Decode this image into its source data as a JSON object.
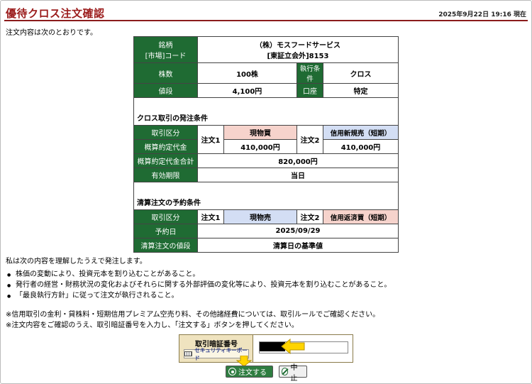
{
  "header": {
    "title": "優待クロス注文確認",
    "datetime": "2025年9月22日 19:16 現在"
  },
  "intro": "注文内容は次のとおりです。",
  "order": {
    "stock_label_1": "銘柄",
    "stock_label_2": "[市場]コード",
    "stock_name": "（株）モスフードサービス",
    "stock_code": "[東証立会外]8153",
    "qty_label": "株数",
    "qty_value": "100株",
    "exec_label": "執行条件",
    "exec_value": "クロス",
    "price_label": "値段",
    "price_value": "4,100円",
    "account_label": "口座",
    "account_value": "特定"
  },
  "cross": {
    "section_title": "クロス取引の発注条件",
    "type_label": "取引区分",
    "estimate_label": "概算約定代金",
    "order1_label": "注文1",
    "order1_type": "現物買",
    "order1_amount": "410,000円",
    "order2_label": "注文2",
    "order2_type": "信用新規売（短期）",
    "order2_amount": "410,000円",
    "total_label": "概算約定代金合計",
    "total_value": "820,000円",
    "expiry_label": "有効期限",
    "expiry_value": "当日"
  },
  "settle": {
    "section_title": "清算注文の予約条件",
    "type_label": "取引区分",
    "order1_label": "注文1",
    "order1_type": "現物売",
    "order2_label": "注文2",
    "order2_type": "信用返済買（短期）",
    "date_label": "予約日",
    "date_value": "2025/09/29",
    "price_label": "清算注文の値段",
    "price_value": "清算日の基準値"
  },
  "understand": "私は次の内容を理解したうえで発注します。",
  "notes": [
    "株価の変動により、投資元本を割り込むことがあること。",
    "発行者の経営・財務状況の変化およびそれらに関する外部評価の変化等により、投資元本を割り込むことがあること。",
    "「最良執行方針」に従って注文が執行されること。"
  ],
  "remarks": [
    "※信用取引の金利・貸株料・短期信用プレミアム空売り料、その他諸経費については、取引ルールでご確認ください。",
    "※注文内容をご確認のうえ、取引暗証番号を入力し、「注文する」ボタンを押してください。"
  ],
  "pin": {
    "label": "取引暗証番号",
    "keyboard_label": "セキュリティキーボード",
    "value": ""
  },
  "buttons": {
    "submit": "注文する",
    "cancel": "中止"
  },
  "colors": {
    "title": "#9b1b1b",
    "header_cell": "#1f6b33",
    "buy_cell": "#f6d3cc",
    "sell_cell": "#d3def4",
    "arrow": "#ffd400"
  }
}
